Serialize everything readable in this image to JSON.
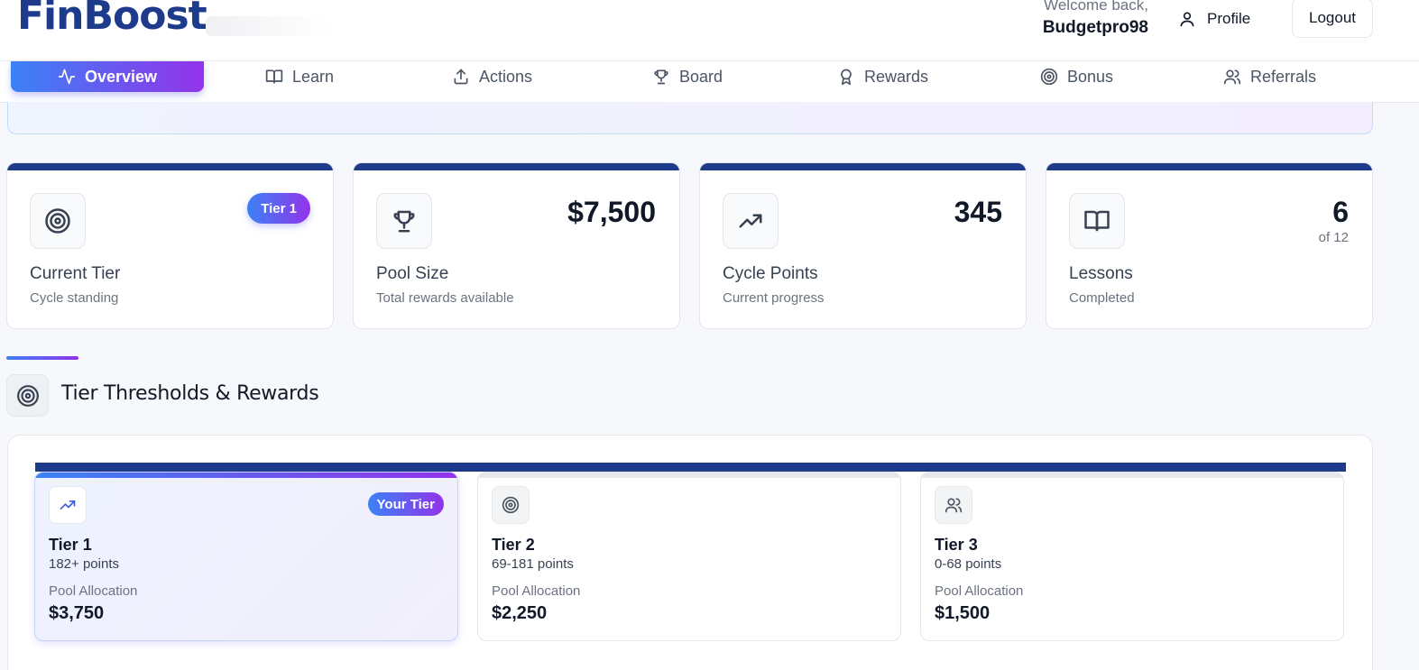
{
  "header": {
    "logo_text": "FinBoost",
    "welcome_line": "Welcome back,",
    "username": "Budgetpro98",
    "profile_label": "Profile",
    "logout_label": "Logout"
  },
  "nav": {
    "items": [
      {
        "label": "Overview",
        "icon": "activity-icon",
        "active": true
      },
      {
        "label": "Learn",
        "icon": "book-icon"
      },
      {
        "label": "Actions",
        "icon": "upload-icon"
      },
      {
        "label": "Board",
        "icon": "trophy-icon"
      },
      {
        "label": "Rewards",
        "icon": "award-icon"
      },
      {
        "label": "Bonus",
        "icon": "target-icon"
      },
      {
        "label": "Referrals",
        "icon": "users-icon"
      }
    ]
  },
  "stats": [
    {
      "title": "Current Tier",
      "subtitle": "Cycle standing",
      "badge": "Tier 1",
      "icon": "target-icon"
    },
    {
      "title": "Pool Size",
      "subtitle": "Total rewards available",
      "value": "$7,500",
      "icon": "trophy-icon"
    },
    {
      "title": "Cycle Points",
      "subtitle": "Current progress",
      "value": "345",
      "icon": "trending-up-icon"
    },
    {
      "title": "Lessons",
      "subtitle": "Completed",
      "value": "6",
      "of": "of 12",
      "icon": "book-open-icon"
    }
  ],
  "tiers_section": {
    "title": "Tier Thresholds & Rewards",
    "pool_label": "Pool Allocation",
    "your_tier_label": "Your Tier",
    "tiers": [
      {
        "name": "Tier 1",
        "points": "182+ points",
        "amount": "$3,750",
        "current": true,
        "icon": "trending-up-icon"
      },
      {
        "name": "Tier 2",
        "points": "69-181 points",
        "amount": "$2,250",
        "icon": "target-icon"
      },
      {
        "name": "Tier 3",
        "points": "0-68 points",
        "amount": "$1,500",
        "icon": "users-icon"
      }
    ]
  },
  "colors": {
    "brand_navy": "#1e3a8a",
    "gradient_start": "#3b82f6",
    "gradient_end": "#9333ea"
  }
}
